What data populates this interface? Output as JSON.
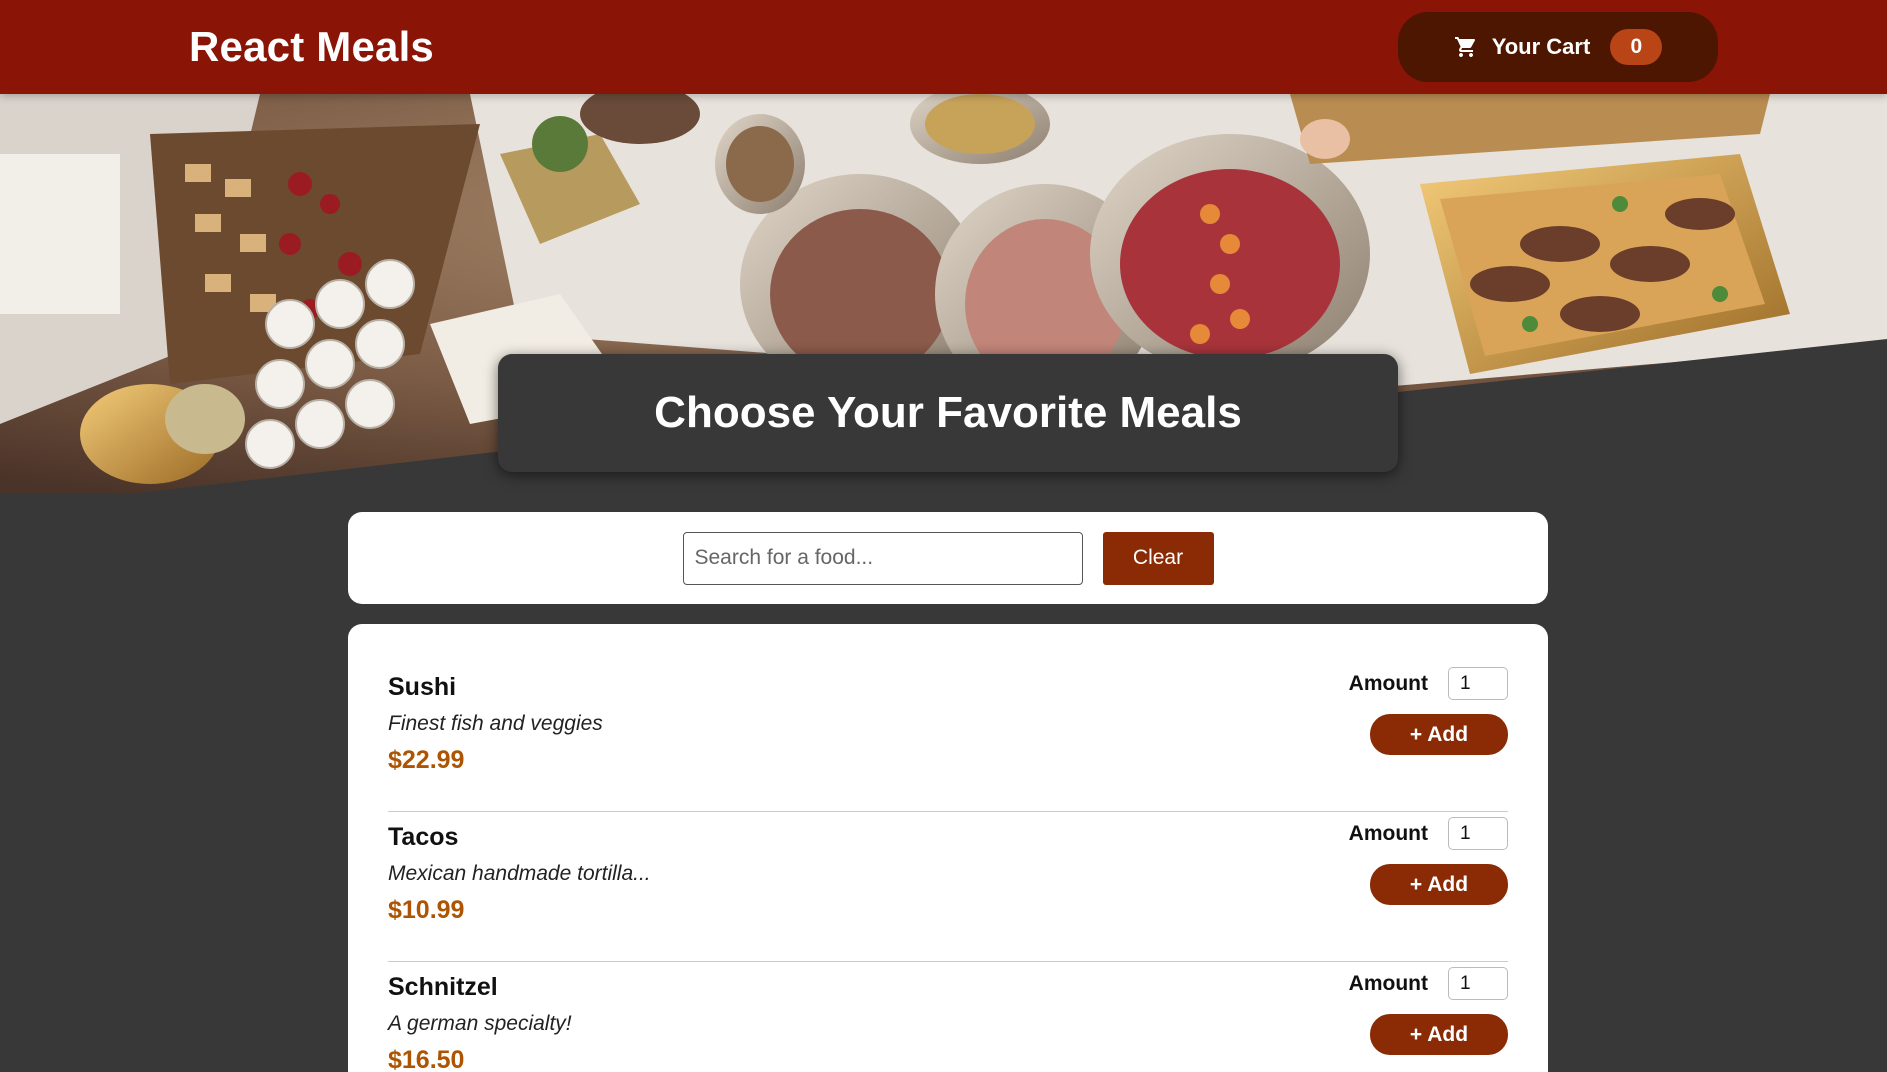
{
  "header": {
    "title": "React Meals",
    "cart_label": "Your Cart",
    "cart_count": "0",
    "cart_icon": "shopping-cart-icon"
  },
  "summary": {
    "title": "Choose Your Favorite Meals"
  },
  "search": {
    "placeholder": "Search for a food...",
    "value": "",
    "clear_label": "Clear"
  },
  "meals": [
    {
      "name": "Sushi",
      "description": "Finest fish and veggies",
      "price": "$22.99",
      "amount_label": "Amount",
      "amount": "1",
      "add_label": "+ Add"
    },
    {
      "name": "Tacos",
      "description": "Mexican handmade tortilla...",
      "price": "$10.99",
      "amount_label": "Amount",
      "amount": "1",
      "add_label": "+ Add"
    },
    {
      "name": "Schnitzel",
      "description": "A german specialty!",
      "price": "$16.50",
      "amount_label": "Amount",
      "amount": "1",
      "add_label": "+ Add"
    }
  ],
  "colors": {
    "header_bg": "#8a1406",
    "body_bg": "#383838",
    "accent": "#8a2b06",
    "price": "#ad5502",
    "cart_bg": "#4d1601",
    "badge_bg": "#b94517"
  }
}
